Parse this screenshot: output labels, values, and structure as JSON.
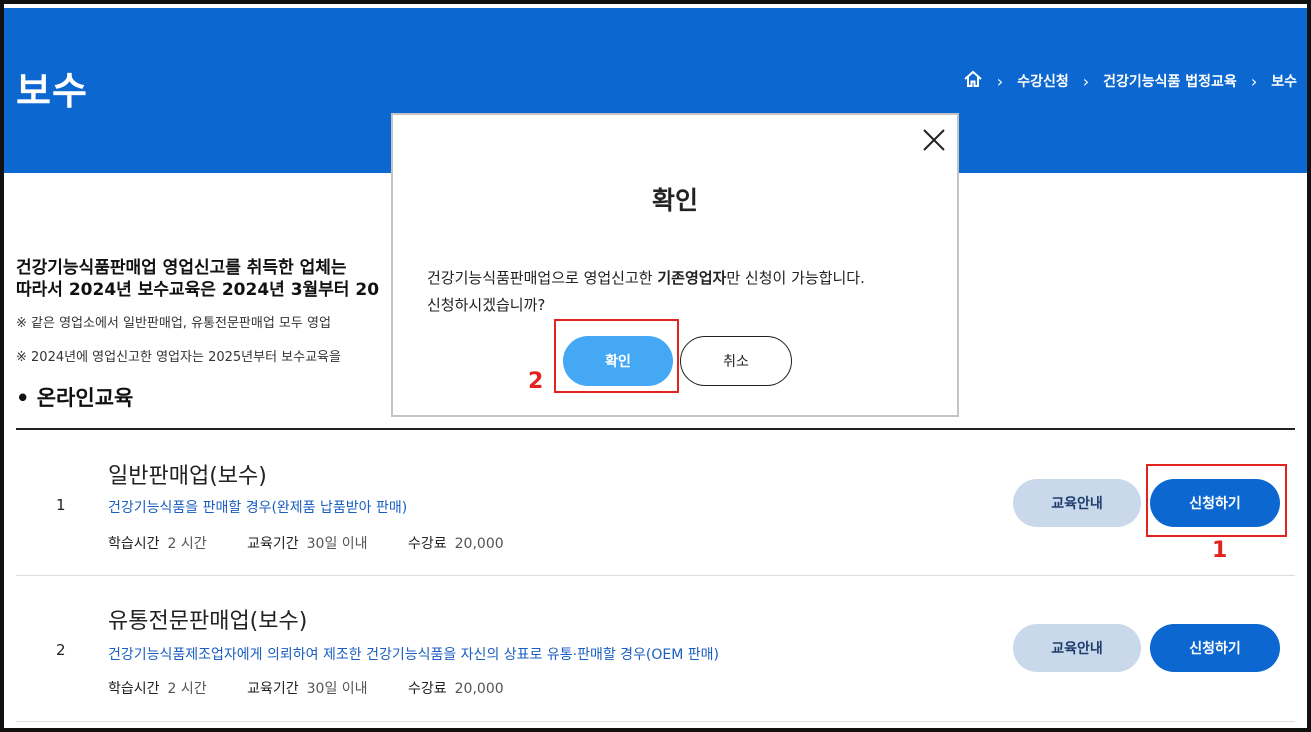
{
  "header": {
    "page_title": "보수",
    "breadcrumb": [
      "수강신청",
      "건강기능식품 법정교육",
      "보수"
    ]
  },
  "notice": {
    "line1": "건강기능식품판매업 영업신고를 취득한 업체는",
    "line2": "따라서 2024년 보수교육은 2024년 3월부터 20",
    "note1": "※ 같은 영업소에서 일반판매업, 유통전문판매업 모두 영업",
    "note2": "※ 2024년에 영업신고한 영업자는 2025년부터 보수교육을"
  },
  "section_title": "온라인교육",
  "courses": [
    {
      "num": "1",
      "name": "일반판매업(보수)",
      "desc": "건강기능식품을 판매할 경우(완제품 납품받아 판매)",
      "hours_label": "학습시간",
      "hours": "2 시간",
      "period_label": "교육기간",
      "period": "30일 이내",
      "fee_label": "수강료",
      "fee": "20,000",
      "guide_label": "교육안내",
      "apply_label": "신청하기"
    },
    {
      "num": "2",
      "name": "유통전문판매업(보수)",
      "desc": "건강기능식품제조업자에게 의뢰하여 제조한 건강기능식품을 자신의 상표로 유통·판매할 경우(OEM 판매)",
      "hours_label": "학습시간",
      "hours": "2 시간",
      "period_label": "교육기간",
      "period": "30일 이내",
      "fee_label": "수강료",
      "fee": "20,000",
      "guide_label": "교육안내",
      "apply_label": "신청하기"
    }
  ],
  "modal": {
    "title": "확인",
    "body_pre": "건강기능식품판매업으로 영업신고한 ",
    "body_bold": "기존영업자",
    "body_post": "만 신청이 가능합니다.",
    "body_line2": "신청하시겠습니까?",
    "ok_label": "확인",
    "cancel_label": "취소"
  },
  "annotations": {
    "step1": "1",
    "step2": "2"
  },
  "colors": {
    "brand_blue": "#0d67d0",
    "highlight_red": "#e2241f",
    "modal_ok": "#45a8f5"
  }
}
